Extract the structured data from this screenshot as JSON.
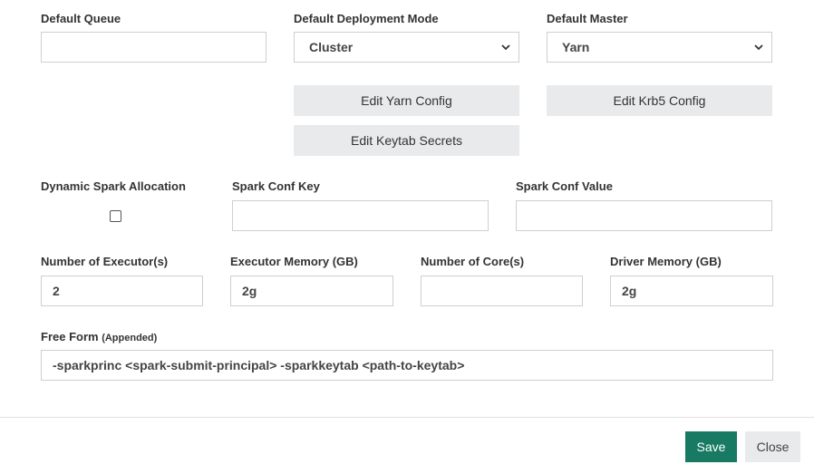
{
  "row1": {
    "default_queue": {
      "label": "Default Queue",
      "value": ""
    },
    "deployment_mode": {
      "label": "Default Deployment Mode",
      "selected": "Cluster"
    },
    "default_master": {
      "label": "Default Master",
      "selected": "Yarn"
    }
  },
  "config_buttons": {
    "edit_yarn": "Edit Yarn Config",
    "edit_krb5": "Edit Krb5 Config",
    "edit_keytab": "Edit Keytab Secrets"
  },
  "row2": {
    "dynamic_allocation": {
      "label": "Dynamic Spark Allocation",
      "checked": false
    },
    "spark_conf_key": {
      "label": "Spark Conf Key",
      "value": ""
    },
    "spark_conf_value": {
      "label": "Spark Conf Value",
      "value": ""
    }
  },
  "row3": {
    "executors": {
      "label": "Number of Executor(s)",
      "value": "2"
    },
    "executor_memory": {
      "label": "Executor Memory (GB)",
      "value": "2g"
    },
    "cores": {
      "label": "Number of Core(s)",
      "value": ""
    },
    "driver_memory": {
      "label": "Driver Memory (GB)",
      "value": "2g"
    }
  },
  "free_form": {
    "label": "Free Form",
    "sublabel": "(Appended)",
    "value": "-sparkprinc <spark-submit-principal> -sparkkeytab <path-to-keytab>"
  },
  "footer": {
    "save_label": "Save",
    "close_label": "Close"
  },
  "colors": {
    "save_bg": "#187a63",
    "secondary_bg": "#e9eaec",
    "border": "#cfcfcf"
  }
}
